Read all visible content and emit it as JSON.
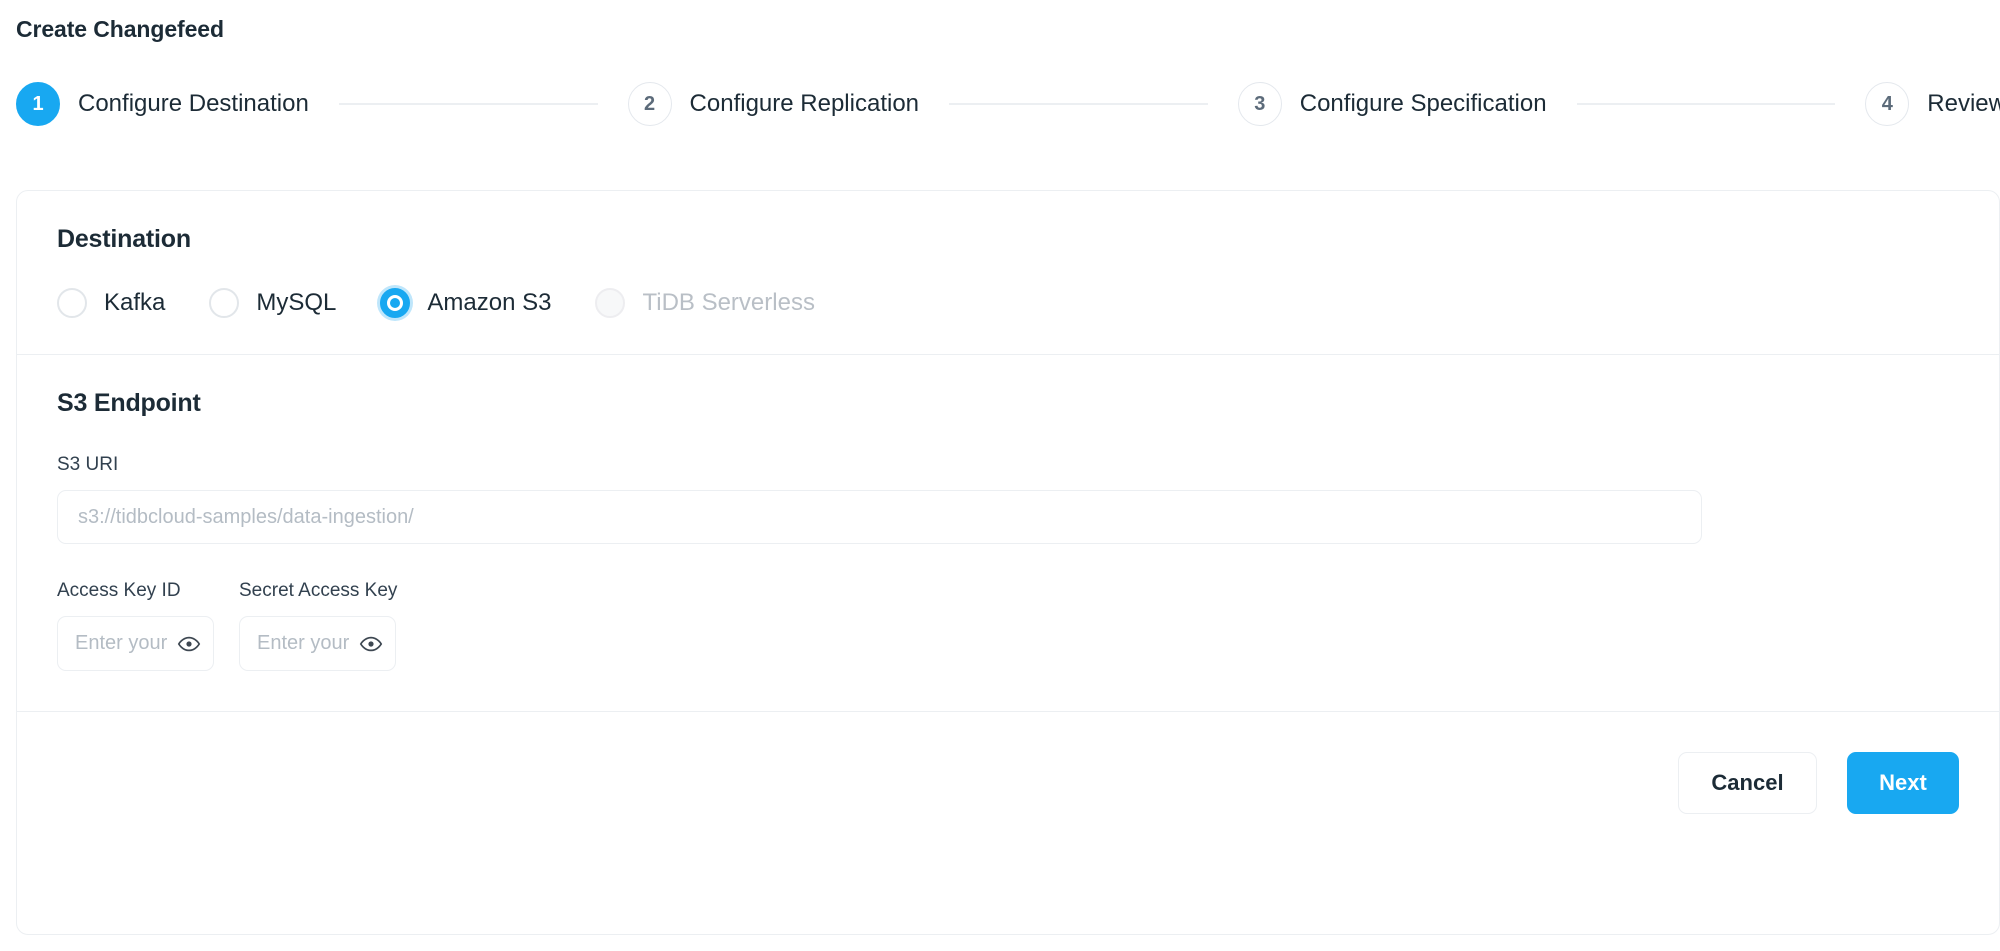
{
  "page": {
    "title": "Create Changefeed"
  },
  "stepper": {
    "steps": [
      {
        "number": "1",
        "label": "Configure Destination",
        "state": "active"
      },
      {
        "number": "2",
        "label": "Configure Replication",
        "state": "inactive"
      },
      {
        "number": "3",
        "label": "Configure Specification",
        "state": "inactive"
      },
      {
        "number": "4",
        "label": "Review",
        "state": "inactive"
      }
    ]
  },
  "destination": {
    "section_title": "Destination",
    "options": [
      {
        "label": "Kafka",
        "selected": false,
        "disabled": false
      },
      {
        "label": "MySQL",
        "selected": false,
        "disabled": false
      },
      {
        "label": "Amazon S3",
        "selected": true,
        "disabled": false
      },
      {
        "label": "TiDB Serverless",
        "selected": false,
        "disabled": true
      }
    ]
  },
  "endpoint": {
    "section_title": "S3 Endpoint",
    "uri_label": "S3 URI",
    "uri_value": "",
    "uri_placeholder": "s3://tidbcloud-samples/data-ingestion/",
    "access_key_label": "Access Key ID",
    "access_key_value": "",
    "access_key_placeholder": "Enter your Access Key ID",
    "secret_key_label": "Secret Access Key",
    "secret_key_value": "",
    "secret_key_placeholder": "Enter your Secret Access Key",
    "reveal_icon": "eye-icon"
  },
  "footer": {
    "cancel_label": "Cancel",
    "next_label": "Next"
  },
  "colors": {
    "accent": "#18a8f1",
    "text": "#1c2b36",
    "muted": "#b4bcc4",
    "border": "#eceff2",
    "focus_ring": "#bfe6fb"
  }
}
